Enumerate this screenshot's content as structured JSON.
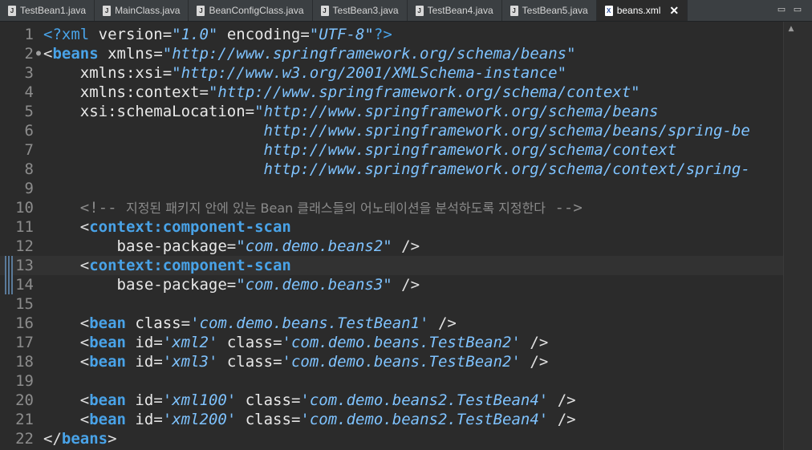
{
  "tabs": [
    {
      "label": "TestBean1.java",
      "icon": "java-file-icon",
      "active": false
    },
    {
      "label": "MainClass.java",
      "icon": "java-file-icon",
      "active": false
    },
    {
      "label": "BeanConfigClass.java",
      "icon": "java-file-icon",
      "active": false
    },
    {
      "label": "TestBean3.java",
      "icon": "java-file-icon",
      "active": false
    },
    {
      "label": "TestBean4.java",
      "icon": "java-file-icon",
      "active": false
    },
    {
      "label": "TestBean5.java",
      "icon": "java-file-icon",
      "active": false
    },
    {
      "label": "beans.xml",
      "icon": "xml-file-icon",
      "active": true
    }
  ],
  "window": {
    "minimize": "▭",
    "maximize": "▭"
  },
  "editor": {
    "current_line": 13,
    "lines": [
      {
        "n": "1",
        "tokens": [
          [
            "t-pi",
            "<?xml "
          ],
          [
            "t-attr",
            "version"
          ],
          [
            "t-punct",
            "="
          ],
          [
            "t-val",
            "\"1.0\""
          ],
          [
            "t-punct",
            " "
          ],
          [
            "t-attr",
            "encoding"
          ],
          [
            "t-punct",
            "="
          ],
          [
            "t-val",
            "\"UTF-8\""
          ],
          [
            "t-pi",
            "?>"
          ]
        ]
      },
      {
        "n": "2",
        "tokens": [
          [
            "t-punct",
            "<"
          ],
          [
            "t-tag",
            "beans"
          ],
          [
            "t-punct",
            " "
          ],
          [
            "t-attr",
            "xmlns"
          ],
          [
            "t-punct",
            "="
          ],
          [
            "t-val",
            "\"http://www.springframework.org/schema/beans\""
          ]
        ]
      },
      {
        "n": "3",
        "tokens": [
          [
            "t-punct",
            "    "
          ],
          [
            "t-attr",
            "xmlns:xsi"
          ],
          [
            "t-punct",
            "="
          ],
          [
            "t-val",
            "\"http://www.w3.org/2001/XMLSchema-instance\""
          ]
        ]
      },
      {
        "n": "4",
        "tokens": [
          [
            "t-punct",
            "    "
          ],
          [
            "t-attr",
            "xmlns:context"
          ],
          [
            "t-punct",
            "="
          ],
          [
            "t-val",
            "\"http://www.springframework.org/schema/context\""
          ]
        ]
      },
      {
        "n": "5",
        "tokens": [
          [
            "t-punct",
            "    "
          ],
          [
            "t-attr",
            "xsi:schemaLocation"
          ],
          [
            "t-punct",
            "="
          ],
          [
            "t-val",
            "\"http://www.springframework.org/schema/beans"
          ]
        ]
      },
      {
        "n": "6",
        "tokens": [
          [
            "t-punct",
            "                        "
          ],
          [
            "t-val",
            "http://www.springframework.org/schema/beans/spring-be"
          ]
        ]
      },
      {
        "n": "7",
        "tokens": [
          [
            "t-punct",
            "                        "
          ],
          [
            "t-val",
            "http://www.springframework.org/schema/context"
          ]
        ]
      },
      {
        "n": "8",
        "tokens": [
          [
            "t-punct",
            "                        "
          ],
          [
            "t-val",
            "http://www.springframework.org/schema/context/spring-"
          ]
        ]
      },
      {
        "n": "9",
        "tokens": []
      },
      {
        "n": "10",
        "tokens": [
          [
            "t-punct",
            "    "
          ],
          [
            "t-comment",
            "<!-- "
          ],
          [
            "t-comment-ko",
            "지정된 패키지 안에 있는 Bean 클래스들의 어노테이션을 분석하도록 지정한다"
          ],
          [
            "t-comment",
            " -->"
          ]
        ]
      },
      {
        "n": "11",
        "tokens": [
          [
            "t-punct",
            "    <"
          ],
          [
            "t-tag",
            "context:component-scan"
          ]
        ]
      },
      {
        "n": "12",
        "tokens": [
          [
            "t-punct",
            "        "
          ],
          [
            "t-attr",
            "base-package"
          ],
          [
            "t-punct",
            "="
          ],
          [
            "t-val",
            "\"com.demo.beans2\""
          ],
          [
            "t-punct",
            " />"
          ]
        ]
      },
      {
        "n": "13",
        "tokens": [
          [
            "t-punct",
            "    <"
          ],
          [
            "t-tag",
            "context:component-scan"
          ]
        ]
      },
      {
        "n": "14",
        "tokens": [
          [
            "t-punct",
            "        "
          ],
          [
            "t-attr",
            "base-package"
          ],
          [
            "t-punct",
            "="
          ],
          [
            "t-val",
            "\"com.demo.beans3\""
          ],
          [
            "t-punct",
            " />"
          ]
        ]
      },
      {
        "n": "15",
        "tokens": []
      },
      {
        "n": "16",
        "tokens": [
          [
            "t-punct",
            "    <"
          ],
          [
            "t-tag",
            "bean"
          ],
          [
            "t-punct",
            " "
          ],
          [
            "t-attr",
            "class"
          ],
          [
            "t-punct",
            "="
          ],
          [
            "t-val",
            "'com.demo.beans.TestBean1'"
          ],
          [
            "t-punct",
            " />"
          ]
        ]
      },
      {
        "n": "17",
        "tokens": [
          [
            "t-punct",
            "    <"
          ],
          [
            "t-tag",
            "bean"
          ],
          [
            "t-punct",
            " "
          ],
          [
            "t-attr",
            "id"
          ],
          [
            "t-punct",
            "="
          ],
          [
            "t-val",
            "'xml2'"
          ],
          [
            "t-punct",
            " "
          ],
          [
            "t-attr",
            "class"
          ],
          [
            "t-punct",
            "="
          ],
          [
            "t-val",
            "'com.demo.beans.TestBean2'"
          ],
          [
            "t-punct",
            " />"
          ]
        ]
      },
      {
        "n": "18",
        "tokens": [
          [
            "t-punct",
            "    <"
          ],
          [
            "t-tag",
            "bean"
          ],
          [
            "t-punct",
            " "
          ],
          [
            "t-attr",
            "id"
          ],
          [
            "t-punct",
            "="
          ],
          [
            "t-val",
            "'xml3'"
          ],
          [
            "t-punct",
            " "
          ],
          [
            "t-attr",
            "class"
          ],
          [
            "t-punct",
            "="
          ],
          [
            "t-val",
            "'com.demo.beans.TestBean2'"
          ],
          [
            "t-punct",
            " />"
          ]
        ]
      },
      {
        "n": "19",
        "tokens": []
      },
      {
        "n": "20",
        "tokens": [
          [
            "t-punct",
            "    <"
          ],
          [
            "t-tag",
            "bean"
          ],
          [
            "t-punct",
            " "
          ],
          [
            "t-attr",
            "id"
          ],
          [
            "t-punct",
            "="
          ],
          [
            "t-val",
            "'xml100'"
          ],
          [
            "t-punct",
            " "
          ],
          [
            "t-attr",
            "class"
          ],
          [
            "t-punct",
            "="
          ],
          [
            "t-val",
            "'com.demo.beans2.TestBean4'"
          ],
          [
            "t-punct",
            " />"
          ]
        ]
      },
      {
        "n": "21",
        "tokens": [
          [
            "t-punct",
            "    <"
          ],
          [
            "t-tag",
            "bean"
          ],
          [
            "t-punct",
            " "
          ],
          [
            "t-attr",
            "id"
          ],
          [
            "t-punct",
            "="
          ],
          [
            "t-val",
            "'xml200'"
          ],
          [
            "t-punct",
            " "
          ],
          [
            "t-attr",
            "class"
          ],
          [
            "t-punct",
            "="
          ],
          [
            "t-val",
            "'com.demo.beans2.TestBean4'"
          ],
          [
            "t-punct",
            " />"
          ]
        ]
      },
      {
        "n": "22",
        "tokens": [
          [
            "t-punct",
            "</"
          ],
          [
            "t-tag",
            "beans"
          ],
          [
            "t-punct",
            ">"
          ]
        ]
      }
    ]
  }
}
